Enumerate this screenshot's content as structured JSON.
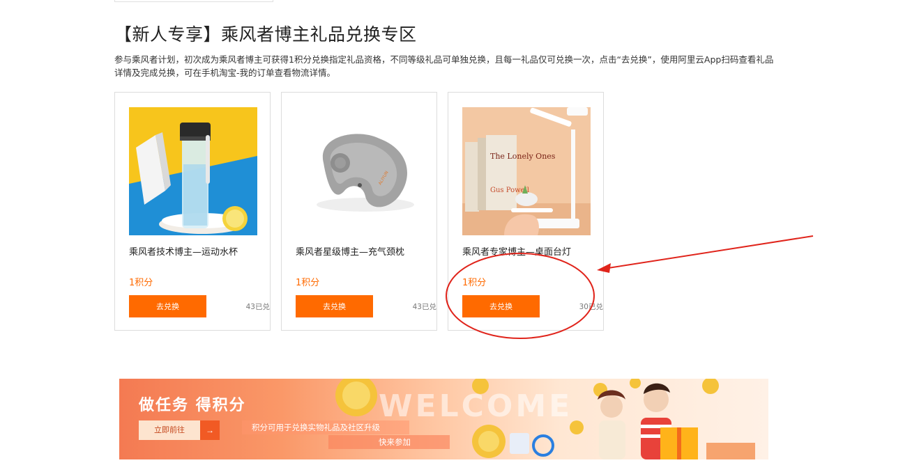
{
  "section": {
    "title": "【新人专享】乘风者博主礼品兑换专区",
    "description": "参与乘风者计划，初次成为乘风者博主可获得1积分兑换指定礼品资格，不同等级礼品可单独兑换，且每一礼品仅可兑换一次，点击“去兑换”，使用阿里云App扫码查看礼品详情及完成兑换，可在手机淘宝-我的订单查看物流详情。"
  },
  "gifts": [
    {
      "name": "乘风者技术博主—运动水杯",
      "points": "1积分",
      "button": "去兑换",
      "redeemed": "43已兑",
      "icon": "water-bottle"
    },
    {
      "name": "乘风者星级博主—充气颈枕",
      "points": "1积分",
      "button": "去兑换",
      "redeemed": "43已兑",
      "icon": "neck-pillow"
    },
    {
      "name": "乘风者专家博主—桌面台灯",
      "points": "1积分",
      "button": "去兑换",
      "redeemed": "30已兑",
      "icon": "desk-lamp"
    }
  ],
  "lamp_books": {
    "book_title": "The Lonely Ones",
    "book_author": "Gus Powell"
  },
  "banner": {
    "title": "做任务 得积分",
    "button": "立即前往",
    "arrow": "→",
    "subtitle": "积分可用于兑换实物礼品及社区升级",
    "cta": "快来参加",
    "decor_text": "WELCOME"
  },
  "colors": {
    "accent": "#ff6a00",
    "annotation": "#e0241b"
  }
}
